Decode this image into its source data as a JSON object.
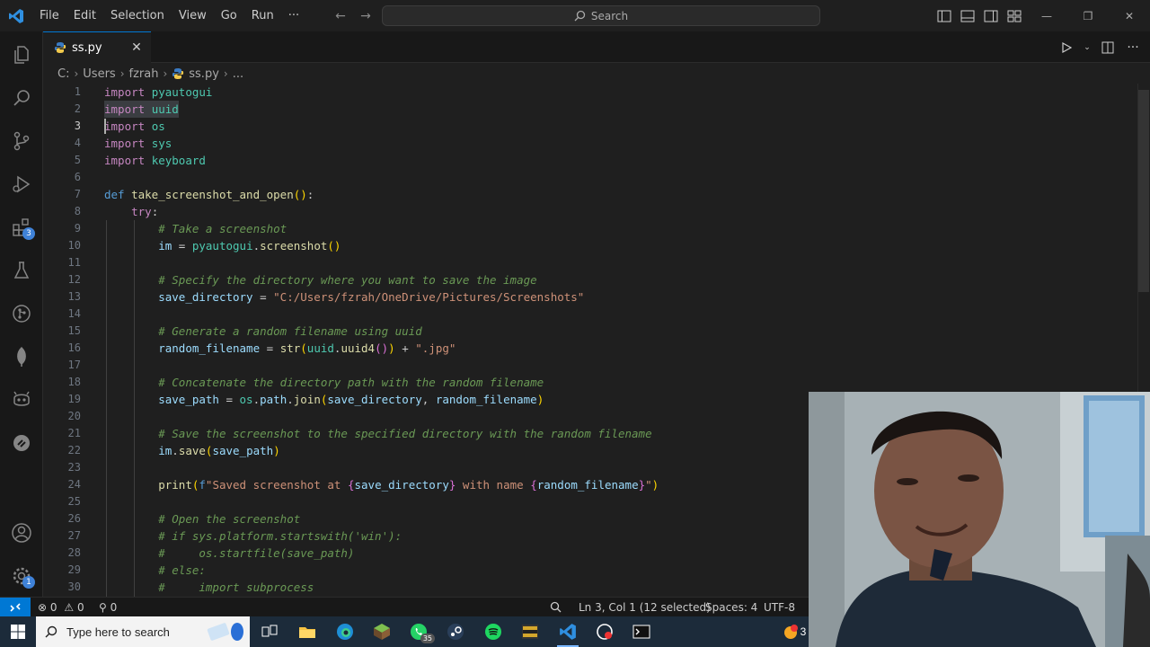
{
  "menu": [
    "File",
    "Edit",
    "Selection",
    "View",
    "Go",
    "Run",
    "···"
  ],
  "search": {
    "label": "Search"
  },
  "tab": {
    "label": "ss.py",
    "close": "✕"
  },
  "breadcrumb": [
    "C:",
    "Users",
    "fzrah",
    "ss.py",
    "..."
  ],
  "activity_badges": {
    "extensions": "3",
    "manage": "1"
  },
  "editor": {
    "active_line": "3",
    "line_numbers": [
      "1",
      "2",
      "3",
      "4",
      "5",
      "6",
      "7",
      "8",
      "9",
      "10",
      "11",
      "12",
      "13",
      "14",
      "15",
      "16",
      "17",
      "18",
      "19",
      "20",
      "21",
      "22",
      "23",
      "24",
      "25",
      "26",
      "27",
      "28",
      "29",
      "30"
    ],
    "lines": [
      "import pyautogui",
      "import uuid",
      "import os",
      "import sys",
      "import keyboard",
      "",
      "def take_screenshot_and_open():",
      "    try:",
      "        # Take a screenshot",
      "        im = pyautogui.screenshot()",
      "",
      "        # Specify the directory where you want to save the image",
      "        save_directory = \"C:/Users/fzrah/OneDrive/Pictures/Screenshots\"",
      "",
      "        # Generate a random filename using uuid",
      "        random_filename = str(uuid.uuid4()) + \".jpg\"",
      "",
      "        # Concatenate the directory path with the random filename",
      "        save_path = os.path.join(save_directory, random_filename)",
      "",
      "        # Save the screenshot to the specified directory with the random filename",
      "        im.save(save_path)",
      "",
      "        print(f\"Saved screenshot at {save_directory} with name {random_filename}\")",
      "",
      "        # Open the screenshot",
      "        # if sys.platform.startswith('win'):",
      "        #     os.startfile(save_path)",
      "        # else:",
      "        #     import subprocess"
    ]
  },
  "statusbar": {
    "errors": "0",
    "warnings": "0",
    "ports": "0",
    "cursor": "Ln 3, Col 1 (12 selected)",
    "spaces": "Spaces: 4",
    "encoding": "UTF-8"
  },
  "taskbar": {
    "search_placeholder": "Type here to search",
    "whatsapp_badge": "35",
    "tray_partial": "3"
  }
}
